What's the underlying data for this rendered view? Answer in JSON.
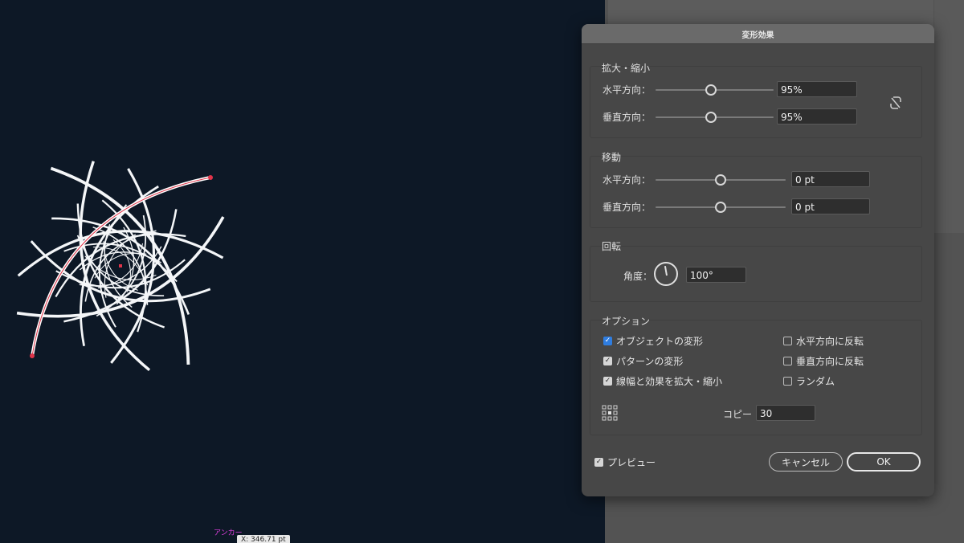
{
  "canvas": {
    "anchor_label": "アンカー",
    "coord_readout": "X: 346.71 pt"
  },
  "dialog": {
    "title": "変形効果",
    "scale": {
      "title": "拡大・縮小",
      "horizontal_label": "水平方向：",
      "horizontal_value": "95%",
      "vertical_label": "垂直方向：",
      "vertical_value": "95%"
    },
    "move": {
      "title": "移動",
      "horizontal_label": "水平方向：",
      "horizontal_value": "0 pt",
      "vertical_label": "垂直方向：",
      "vertical_value": "0 pt"
    },
    "rotate": {
      "title": "回転",
      "angle_label": "角度：",
      "angle_value": "100°"
    },
    "options": {
      "title": "オプション",
      "transform_objects": "オブジェクトの変形",
      "transform_patterns": "パターンの変形",
      "scale_strokes": "線幅と効果を拡大・縮小",
      "reflect_x": "水平方向に反転",
      "reflect_y": "垂直方向に反転",
      "random": "ランダム"
    },
    "copies_label": "コピー",
    "copies_value": "30",
    "preview_label": "プレビュー",
    "cancel_label": "キャンセル",
    "ok_label": "OK"
  },
  "colors": {
    "canvas_bg": "#0d1826",
    "dialog_bg": "#474747",
    "accent_checkbox": "#2f7de0",
    "selection_path": "#e0344a"
  }
}
